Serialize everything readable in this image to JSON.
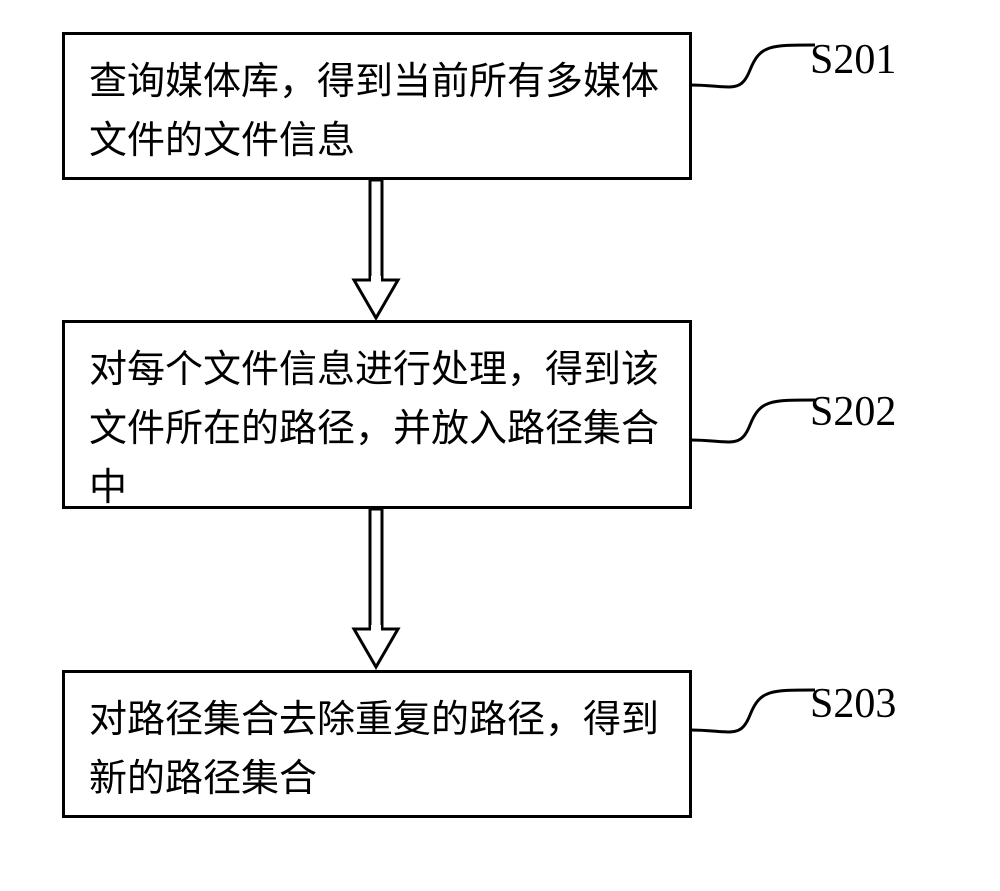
{
  "steps": [
    {
      "text": "查询媒体库，得到当前所有多媒体文件的文件信息",
      "label": "S201"
    },
    {
      "text": "对每个文件信息进行处理，得到该文件所在的路径，并放入路径集合中",
      "label": "S202"
    },
    {
      "text": "对路径集合去除重复的路径，得到新的路径集合",
      "label": "S203"
    }
  ]
}
